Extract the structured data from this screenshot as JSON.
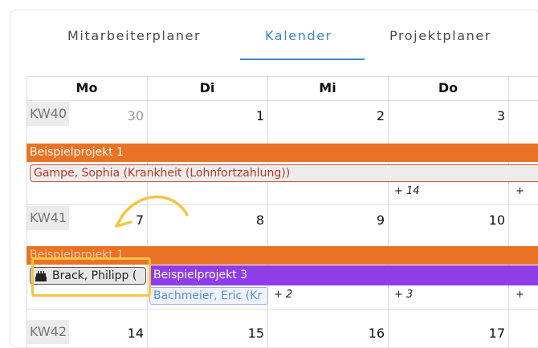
{
  "tabs": [
    {
      "label": "Mitarbeiterplaner",
      "active": false
    },
    {
      "label": "Kalender",
      "active": true
    },
    {
      "label": "Projektplaner",
      "active": false
    }
  ],
  "weekdays": [
    "Mo",
    "Di",
    "Mi",
    "Do"
  ],
  "weeks": [
    {
      "kw": "KW40",
      "days": [
        "30",
        "1",
        "2",
        "3"
      ],
      "project_bar": "Beispielprojekt 1",
      "absence": "Gampe, Sophia (Krankheit (Lohnfortzahlung))",
      "more": [
        "+ 14",
        "+"
      ]
    },
    {
      "kw": "KW41",
      "days": [
        "7",
        "8",
        "9",
        "10"
      ],
      "project_bar": "Beispielprojekt 1",
      "birthday": "Brack, Philipp (",
      "project_bar_2": "Beispielprojekt 3",
      "assignee": "Bachmeier, Eric (Kr",
      "more": [
        "+ 2",
        "+ 3",
        "+"
      ]
    },
    {
      "kw": "KW42",
      "days": [
        "14",
        "15",
        "16",
        "17"
      ]
    }
  ],
  "colors": {
    "accent": "#3a87c9",
    "project_orange": "#e97225",
    "project_purple": "#8e3de8",
    "highlight": "#f6c443"
  },
  "icons": {
    "birthday": "cake-icon",
    "annotation": "curved-arrow-icon"
  }
}
